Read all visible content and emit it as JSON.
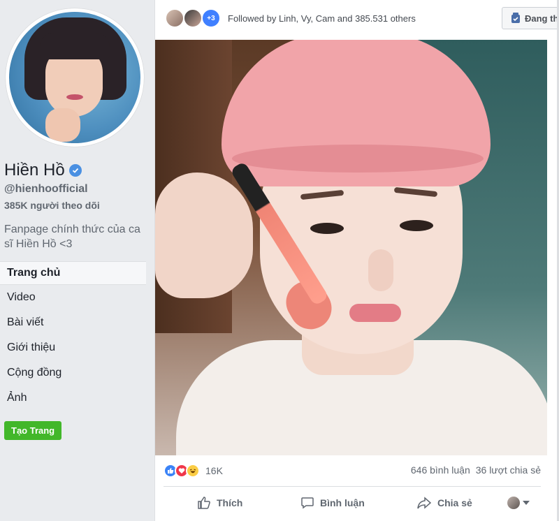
{
  "profile": {
    "name": "Hiền Hồ",
    "handle": "@hienhoofficial",
    "followers": "385K người theo dõi",
    "about": "Fanpage chính thức của ca sĩ Hiền Hồ <3"
  },
  "nav": {
    "items": [
      {
        "label": "Trang chủ"
      },
      {
        "label": "Video"
      },
      {
        "label": "Bài viết"
      },
      {
        "label": "Giới thiệu"
      },
      {
        "label": "Cộng đồng"
      },
      {
        "label": "Ảnh"
      }
    ],
    "create_page": "Tạo Trang"
  },
  "post": {
    "followed_more_badge": "+3",
    "followed_text": "Followed by Linh, Vy, Cam and 385.531 others",
    "follow_button": "Đang th",
    "reactions_count": "16K",
    "comments": "646 bình luận",
    "shares": "36 lượt chia sẻ",
    "actions": {
      "like": "Thích",
      "comment": "Bình luận",
      "share": "Chia sẻ"
    }
  },
  "colors": {
    "accent": "#4080ff",
    "create_button": "#42b72a",
    "verified": "#4a90e2"
  }
}
